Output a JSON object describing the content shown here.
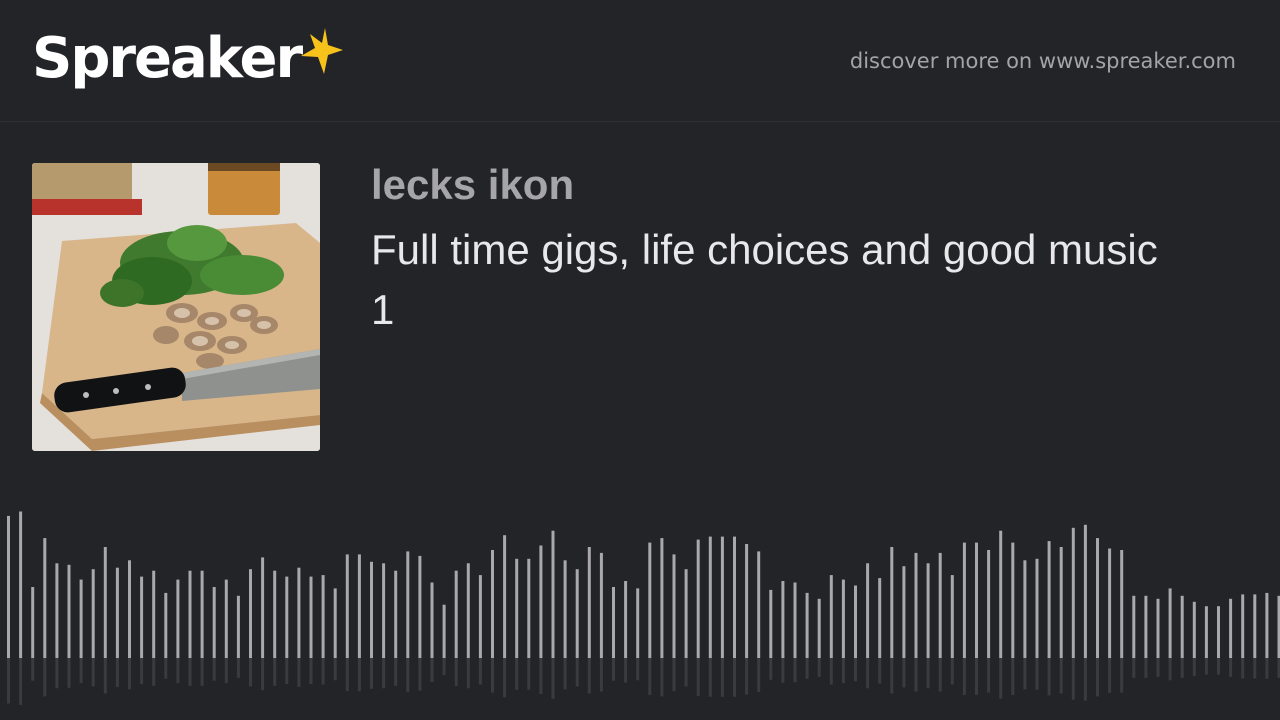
{
  "brand": {
    "name": "Spreaker",
    "tagline": "discover more on www.spreaker.com",
    "star_color": "#f7c21a"
  },
  "episode": {
    "author": "lecks ikon",
    "title": "Full time gigs, life choices and good music 1",
    "cover_icon": "cutting-board-with-spinach-mushrooms-and-knife"
  },
  "waveform": {
    "bar_color": "#a9a9ad",
    "reflection_color": "#3a3b3f",
    "levels": [
      0.96,
      0.99,
      0.48,
      0.81,
      0.64,
      0.63,
      0.53,
      0.6,
      0.75,
      0.61,
      0.66,
      0.55,
      0.59,
      0.44,
      0.53,
      0.59,
      0.59,
      0.48,
      0.53,
      0.42,
      0.6,
      0.68,
      0.59,
      0.55,
      0.61,
      0.55,
      0.56,
      0.47,
      0.7,
      0.7,
      0.65,
      0.64,
      0.59,
      0.72,
      0.69,
      0.51,
      0.36,
      0.59,
      0.64,
      0.56,
      0.73,
      0.83,
      0.67,
      0.67,
      0.76,
      0.86,
      0.66,
      0.6,
      0.75,
      0.71,
      0.48,
      0.52,
      0.47,
      0.78,
      0.81,
      0.7,
      0.6,
      0.8,
      0.82,
      0.82,
      0.82,
      0.77,
      0.72,
      0.46,
      0.52,
      0.51,
      0.44,
      0.4,
      0.56,
      0.53,
      0.49,
      0.64,
      0.54,
      0.75,
      0.62,
      0.71,
      0.64,
      0.71,
      0.56,
      0.78,
      0.78,
      0.73,
      0.86,
      0.78,
      0.66,
      0.67,
      0.79,
      0.75,
      0.88,
      0.9,
      0.81,
      0.74,
      0.73,
      0.42,
      0.42,
      0.4,
      0.47,
      0.42,
      0.38,
      0.35,
      0.35,
      0.4,
      0.43,
      0.43,
      0.44,
      0.42,
      0.48
    ]
  }
}
